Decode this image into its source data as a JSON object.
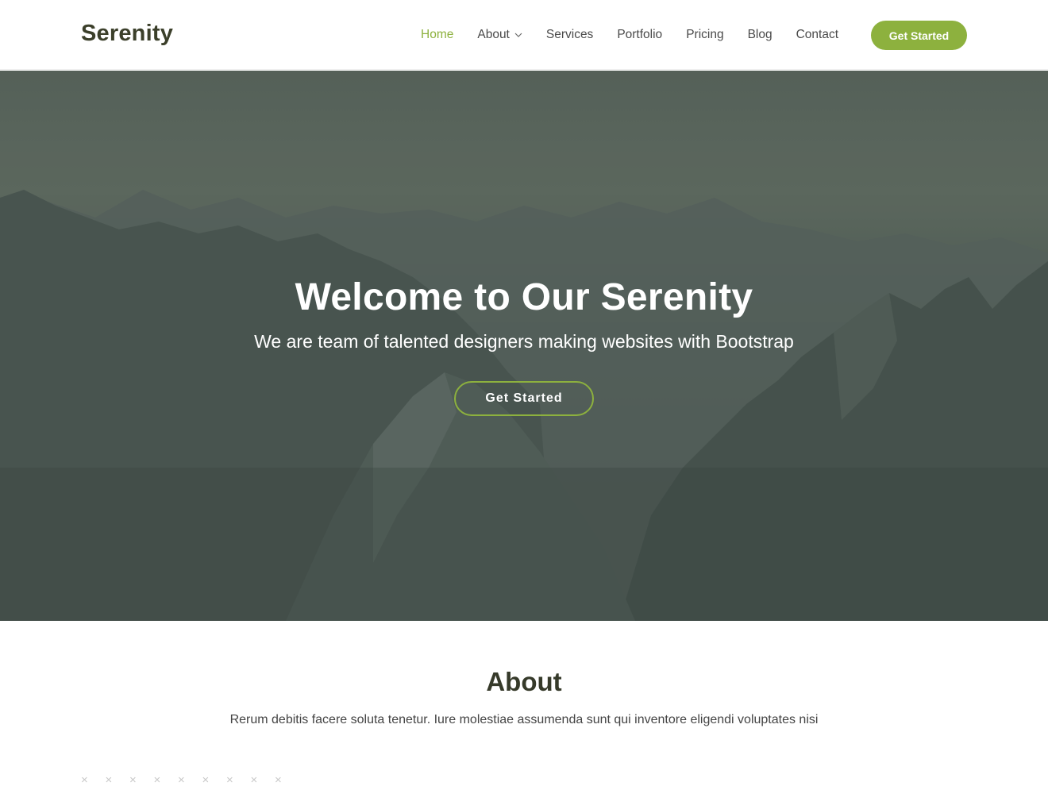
{
  "header": {
    "logo": "Serenity",
    "nav": [
      {
        "label": "Home",
        "active": true
      },
      {
        "label": "About",
        "dropdown": true
      },
      {
        "label": "Services"
      },
      {
        "label": "Portfolio"
      },
      {
        "label": "Pricing"
      },
      {
        "label": "Blog"
      },
      {
        "label": "Contact"
      }
    ],
    "cta_label": "Get Started"
  },
  "hero": {
    "title": "Welcome to Our Serenity",
    "subtitle": "We are team of talented designers making websites with Bootstrap",
    "button_label": "Get Started"
  },
  "about": {
    "title": "About",
    "text": "Rerum debitis facere soluta tenetur. Iure molestiae assumenda sunt qui inventore eligendi voluptates nisi",
    "decor_icon": "x-pattern-icon"
  },
  "colors": {
    "accent": "#8db13e",
    "heading": "#363a2a"
  }
}
